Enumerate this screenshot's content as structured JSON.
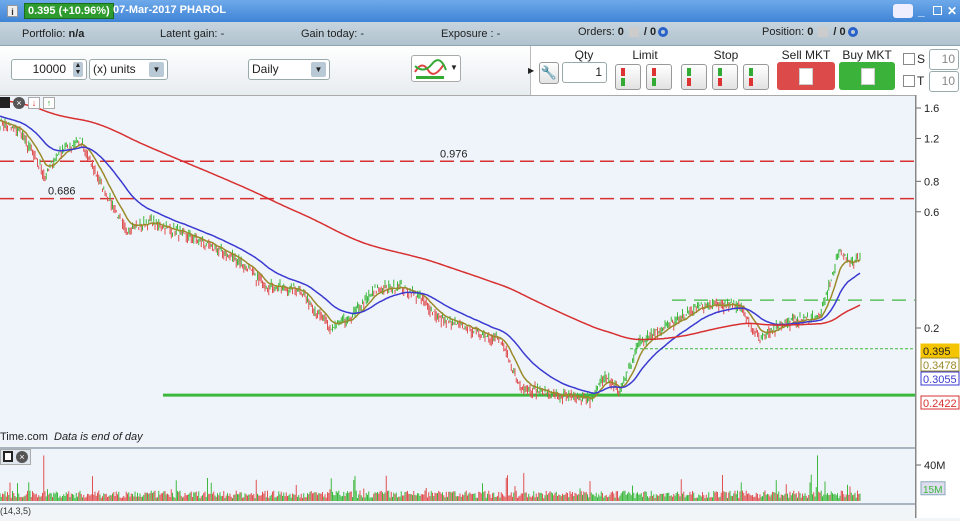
{
  "titlebar": {
    "price": "0.395 (+10.96%)",
    "title": "07-Mar-2017 PHAROL"
  },
  "infobar": {
    "portfolio_label": "Portfolio:",
    "portfolio_value": "n/a",
    "latent_label": "Latent gain:",
    "latent_value": "-",
    "gain_label": "Gain today:",
    "gain_value": "-",
    "exposure_label": "Exposure :",
    "exposure_value": "-",
    "orders_label": "Orders:",
    "orders_value": "0",
    "orders_total": "/ 0",
    "position_label": "Position:",
    "position_value": "0",
    "position_total": "/ 0"
  },
  "toolbar": {
    "quantity": "10000",
    "unit": "(x) units",
    "period": "Daily"
  },
  "orders": {
    "qty_label": "Qty",
    "qty_value": "1",
    "limit_label": "Limit",
    "stop_label": "Stop",
    "sell_label": "Sell MKT",
    "buy_label": "Buy MKT",
    "s_label": "S",
    "s_value": "10",
    "t_label": "T",
    "t_value": "10"
  },
  "chart": {
    "source": "Time.com",
    "note": "Data is end of day",
    "volume_tag": "15M",
    "footer": "(14,3,5)"
  },
  "colors": {
    "up": "#3cb83c",
    "down": "#e05050",
    "ma_short": "#9b8a2a",
    "ma_mid": "#3a3ad0",
    "ma_long": "#d83030"
  },
  "chart_data": {
    "type": "line",
    "yscale": "log",
    "ylim": [
      0.095,
      1.75
    ],
    "yticks": [
      "1.6",
      "1.2",
      "0.8",
      "0.6",
      "0.2"
    ],
    "ytick_values": [
      1.6,
      1.2,
      0.8,
      0.6,
      0.2
    ],
    "price_anchors": [
      [
        0,
        1.4
      ],
      [
        4,
        1.3
      ],
      [
        9,
        0.85
      ],
      [
        12,
        1.08
      ],
      [
        16,
        1.18
      ],
      [
        20,
        0.81
      ],
      [
        25,
        0.51
      ],
      [
        30,
        0.55
      ],
      [
        40,
        0.46
      ],
      [
        48,
        0.38
      ],
      [
        53,
        0.3
      ],
      [
        60,
        0.29
      ],
      [
        66,
        0.2
      ],
      [
        70,
        0.22
      ],
      [
        75,
        0.29
      ],
      [
        80,
        0.3
      ],
      [
        84,
        0.27
      ],
      [
        88,
        0.22
      ],
      [
        94,
        0.2
      ],
      [
        100,
        0.18
      ],
      [
        104,
        0.117
      ],
      [
        112,
        0.106
      ],
      [
        118,
        0.103
      ],
      [
        121,
        0.128
      ],
      [
        124,
        0.11
      ],
      [
        128,
        0.18
      ],
      [
        136,
        0.22
      ],
      [
        140,
        0.25
      ],
      [
        148,
        0.25
      ],
      [
        152,
        0.18
      ],
      [
        156,
        0.21
      ],
      [
        164,
        0.225
      ],
      [
        168,
        0.42
      ],
      [
        170,
        0.373
      ],
      [
        172,
        0.395
      ]
    ],
    "levels": [
      {
        "value": 0.976,
        "label": "0.976",
        "style": "red-dashed"
      },
      {
        "value": 0.686,
        "label": "0.686",
        "style": "red-dashed"
      },
      {
        "value": 0.107,
        "style": "green-solid"
      },
      {
        "value": 0.2627,
        "style": "green-dashed"
      },
      {
        "value": 0.166,
        "style": "green-dotted"
      }
    ],
    "last_labels": [
      {
        "value": 0.395,
        "label": "0.395",
        "color": "#f5c400"
      },
      {
        "value": 0.3478,
        "label": "0.3478",
        "color": "#9b8a2a"
      },
      {
        "value": 0.3055,
        "label": "0.3055",
        "color": "#3a3ad0"
      },
      {
        "value": 0.2422,
        "label": "0.2422",
        "color": "#d83030"
      }
    ],
    "volume_ticks": [
      "40M"
    ],
    "volume_tick_values": [
      40
    ]
  }
}
